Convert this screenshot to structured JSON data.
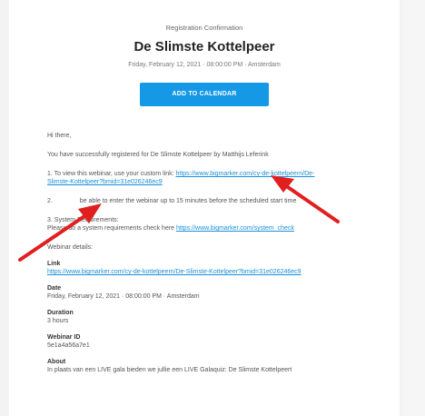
{
  "header": {
    "kicker": "Registration Confirmation",
    "title": "De Slimste Kottelpeer",
    "datetime": "Friday, February 12, 2021 · 08:00:00 PM · Amsterdam"
  },
  "cta": {
    "label": "ADD TO CALENDAR"
  },
  "email": {
    "greeting": "Hi there,",
    "registered": "You have successfully registered for De Slimste Kottelpeer by Matthijs Leferink",
    "step1_text": "1. To view this webinar, use your custom link: ",
    "step1_link_a": "https://www.bigmarker.com/cy-de-kottelpeern/De-",
    "step1_link_b": "Slimste-Kottelpeer?bmid=31e026246ec9",
    "step2_prefix": "2. ",
    "step2_text": "be able to enter the webinar up to 15 minutes before the scheduled start time",
    "step3_title": "3. System Requirements:",
    "step3_text": "Please do a system requirements check here ",
    "step3_link": "https://www.bigmarker.com/system_check",
    "details_heading": "Webinar details:"
  },
  "details": {
    "link_label": "Link",
    "link_value": "https://www.bigmarker.com/cy-de-kottelpeern/De-Slimste-Kottelpeer?bmid=31e026246ec9",
    "date_label": "Date",
    "date_value": "Friday, February 12, 2021 · 08:00:00 PM · Amsterdam",
    "duration_label": "Duration",
    "duration_value": "3 hours",
    "id_label": "Webinar ID",
    "id_value": "5e1a4a56a7e1",
    "about_label": "About",
    "about_value": "In plaats van een LIVE gala bieden we jullie een LIVE Galaquiz: De Slimste Kottelpeert"
  },
  "colors": {
    "accent": "#1598e6",
    "link": "#1a8fd8",
    "arrow": "#e11f1f"
  }
}
